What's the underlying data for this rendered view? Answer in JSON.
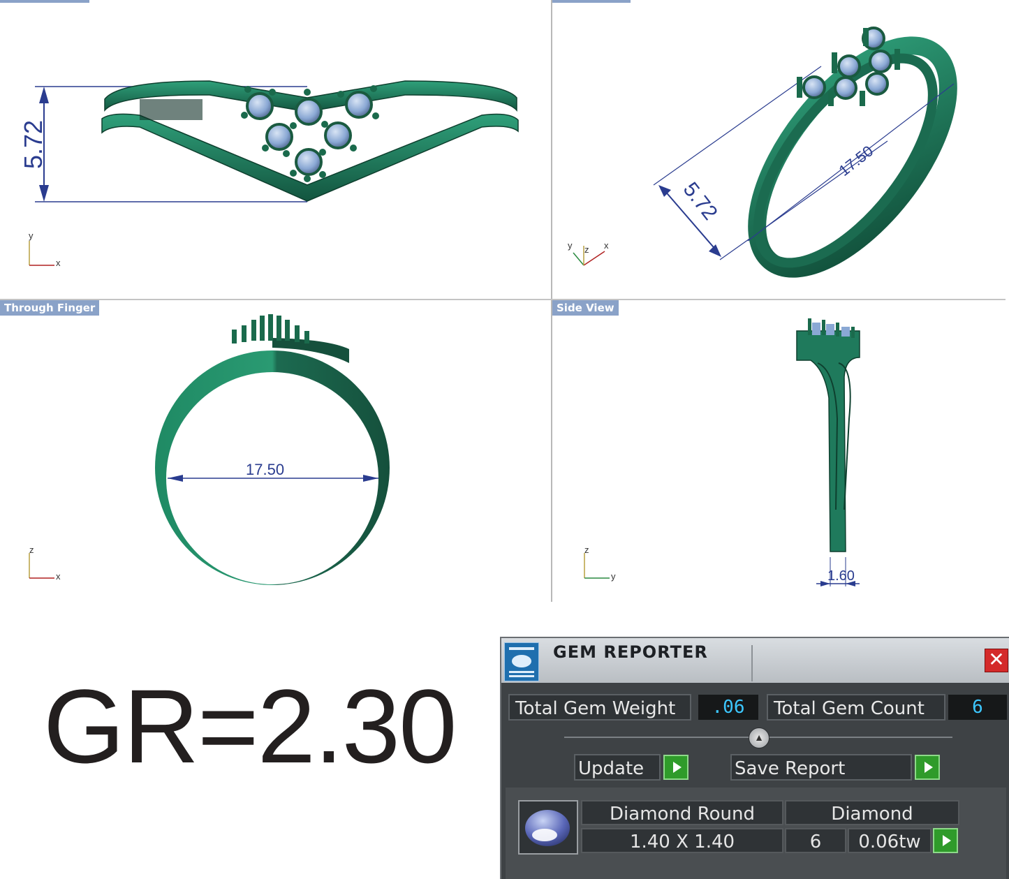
{
  "viewports": {
    "top_left": {
      "label": "",
      "dimension": "5.72",
      "axes": [
        "y",
        "x"
      ]
    },
    "top_right": {
      "label": "",
      "dimension_a": "5.72",
      "dimension_b": "17.50",
      "axes": [
        "y",
        "z",
        "x"
      ]
    },
    "bottom_left": {
      "label": "Through Finger",
      "dimension": "17.50",
      "axes": [
        "z",
        "x"
      ]
    },
    "bottom_right": {
      "label": "Side View",
      "dimension": "1.60",
      "axes": [
        "z",
        "y"
      ]
    }
  },
  "gr_label": "GR=2.30",
  "gem_reporter": {
    "title": "GEM REPORTER",
    "close_glyph": "✕",
    "total_weight_label": "Total Gem Weight",
    "total_weight_value": ".06",
    "total_count_label": "Total Gem Count",
    "total_count_value": "6",
    "update_label": "Update",
    "save_label": "Save Report",
    "gem": {
      "shape": "Diamond Round",
      "type": "Diamond",
      "size": "1.40 X 1.40",
      "count": "6",
      "weight": "0.06tw"
    }
  },
  "colors": {
    "ring_green": "#1f7a5c",
    "stone_blue": "#8aa8d4",
    "dimension_blue": "#2a3c8f",
    "panel_bg": "#3e4245",
    "value_cyan": "#3cc7ff"
  }
}
